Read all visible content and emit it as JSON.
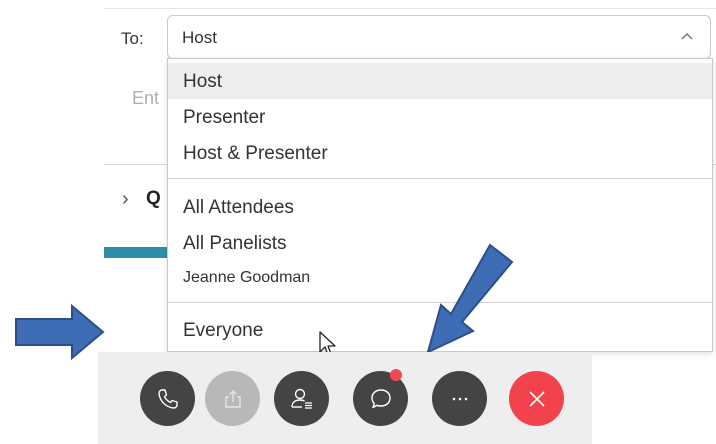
{
  "chat": {
    "to_label": "To:",
    "to_value": "Host",
    "message_placeholder_fragment": "Ent",
    "qa_label_fragment": "Q"
  },
  "dropdown": {
    "items_group1": [
      "Host",
      "Presenter",
      "Host & Presenter"
    ],
    "items_group2": [
      "All Attendees",
      "All Panelists",
      "Jeanne Goodman"
    ],
    "items_group3": [
      "Everyone"
    ],
    "selected": "Host"
  },
  "toolbar": {
    "buttons": [
      {
        "name": "audio-button",
        "icon": "phone-icon",
        "state": "active"
      },
      {
        "name": "share-button",
        "icon": "share-icon",
        "state": "disabled"
      },
      {
        "name": "participants-button",
        "icon": "participants-icon",
        "state": "active"
      },
      {
        "name": "chat-button",
        "icon": "chat-bubble-icon",
        "state": "active",
        "notification": true
      },
      {
        "name": "more-button",
        "icon": "ellipsis-icon",
        "state": "active"
      },
      {
        "name": "leave-button",
        "icon": "close-icon",
        "state": "danger"
      }
    ]
  },
  "colors": {
    "arrow": "#3f6db5",
    "leave": "#f2424b",
    "button": "#444444",
    "notification": "#f04a55"
  }
}
